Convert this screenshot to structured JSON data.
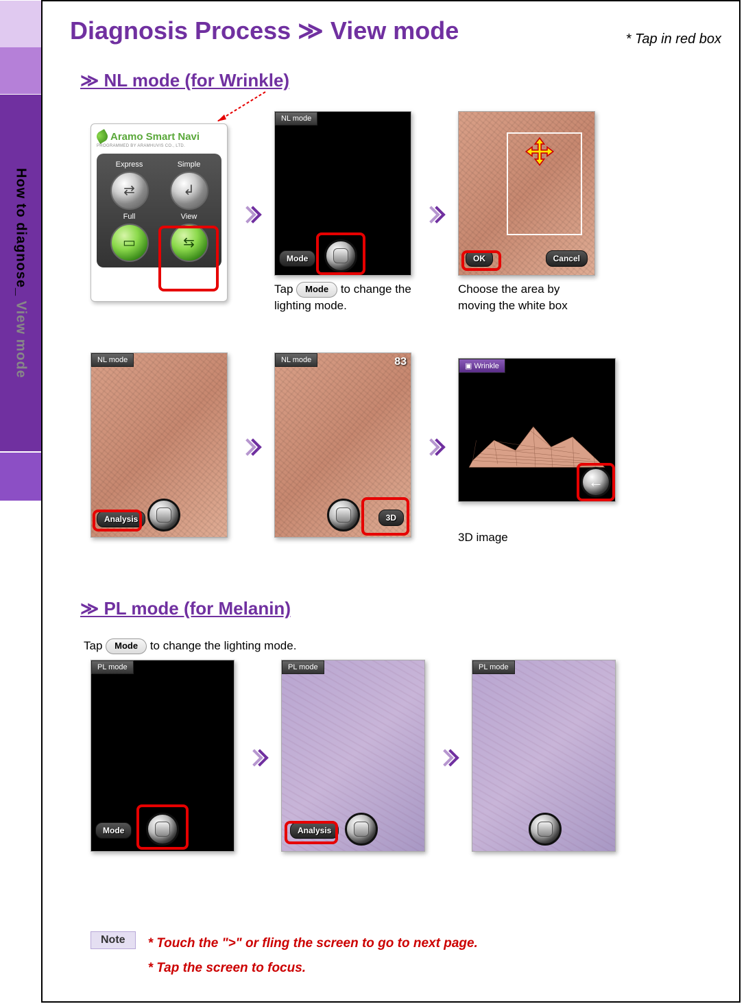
{
  "header": {
    "title_prefix": "Diagnosis Process",
    "title_sep": "≫",
    "title_suffix": "View mode",
    "hint": "* Tap in red box"
  },
  "sidebar": {
    "label_prefix": "How to diagnose_ ",
    "label_em": "View mode"
  },
  "nl": {
    "heading": "≫ NL mode (for Wrinkle)",
    "device": {
      "brand": "Aramo Smart Navi",
      "sub": "PROGRAMMED BY ARAMHUVIS CO., LTD.",
      "btns": [
        "Express",
        "Simple",
        "Full",
        "View"
      ]
    },
    "step2": {
      "badge": "NL mode",
      "mode_pill": "Mode",
      "caption_pre": "Tap ",
      "mode_chip": "Mode",
      "caption_post": " to change the lighting mode."
    },
    "step3": {
      "ok": "OK",
      "cancel": "Cancel",
      "caption": "Choose the area by moving the white box"
    },
    "step4": {
      "badge": "NL mode",
      "analysis": "Analysis"
    },
    "step5": {
      "badge": "NL mode",
      "score": "83",
      "threeD": "3D"
    },
    "step6": {
      "badge": "Wrinkle",
      "caption": "3D image"
    }
  },
  "pl": {
    "heading": "≫ PL mode (for Melanin)",
    "intro_pre": "Tap ",
    "mode_chip": "Mode",
    "intro_post": " to change the lighting mode.",
    "step1": {
      "badge": "PL mode",
      "mode_pill": "Mode"
    },
    "step2": {
      "badge": "PL mode",
      "analysis": "Analysis"
    },
    "step3": {
      "badge": "PL mode"
    }
  },
  "note": {
    "label": "Note",
    "line1": "* Touch the \">\" or fling the screen to go to next page.",
    "line2": "* Tap the screen to focus."
  }
}
